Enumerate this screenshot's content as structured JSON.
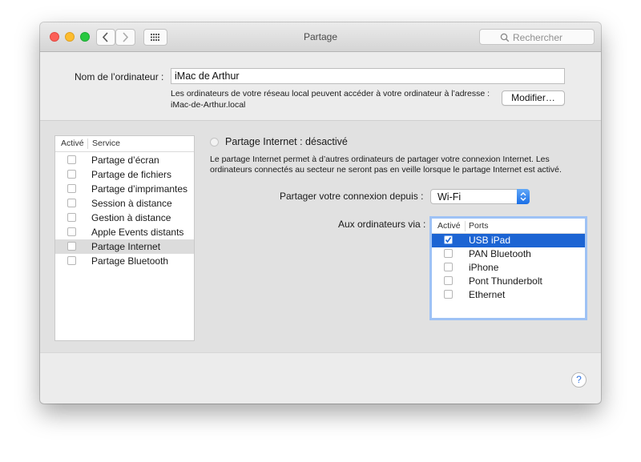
{
  "window": {
    "title": "Partage"
  },
  "toolbar": {
    "search_placeholder": "Rechercher"
  },
  "computer_name": {
    "label": "Nom de l’ordinateur :",
    "value": "iMac de Arthur",
    "description_line1": "Les ordinateurs de votre réseau local peuvent accéder à votre ordinateur à l’adresse :",
    "description_line2": "iMac-de-Arthur.local",
    "edit_button": "Modifier…"
  },
  "services": {
    "header_active": "Activé",
    "header_service": "Service",
    "items": [
      {
        "label": "Partage d’écran",
        "checked": false,
        "selected": false
      },
      {
        "label": "Partage de fichiers",
        "checked": false,
        "selected": false
      },
      {
        "label": "Partage d’imprimantes",
        "checked": false,
        "selected": false
      },
      {
        "label": "Session à distance",
        "checked": false,
        "selected": false
      },
      {
        "label": "Gestion à distance",
        "checked": false,
        "selected": false
      },
      {
        "label": "Apple Events distants",
        "checked": false,
        "selected": false
      },
      {
        "label": "Partage Internet",
        "checked": false,
        "selected": true
      },
      {
        "label": "Partage Bluetooth",
        "checked": false,
        "selected": false
      }
    ]
  },
  "detail": {
    "status": "Partage Internet : désactivé",
    "description_line1": "Le partage Internet permet à d’autres ordinateurs de partager votre connexion Internet. Les",
    "description_line2": "ordinateurs connectés au secteur ne seront pas en veille lorsque le partage Internet est activé.",
    "share_from_label": "Partager votre connexion depuis :",
    "share_from_value": "Wi-Fi",
    "to_computers_label": "Aux ordinateurs via :",
    "ports_header_active": "Activé",
    "ports_header_ports": "Ports",
    "ports": [
      {
        "label": "USB iPad",
        "checked": true,
        "selected": true
      },
      {
        "label": "PAN Bluetooth",
        "checked": false,
        "selected": false
      },
      {
        "label": "iPhone",
        "checked": false,
        "selected": false
      },
      {
        "label": "Pont Thunderbolt",
        "checked": false,
        "selected": false
      },
      {
        "label": "Ethernet",
        "checked": false,
        "selected": false
      }
    ]
  },
  "help": {
    "label": "?"
  },
  "colors": {
    "accent": "#1c64d3",
    "close": "#fc5f57",
    "minimize": "#fdbc2e",
    "zoom": "#28c840"
  }
}
